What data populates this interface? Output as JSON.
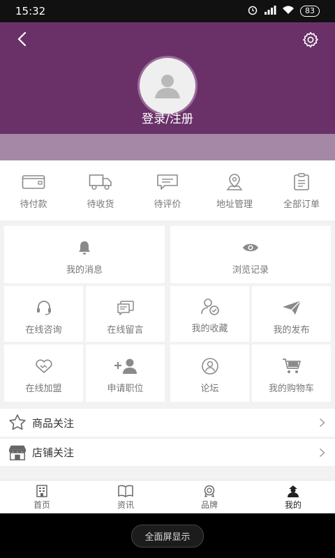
{
  "status_bar": {
    "time": "15:32",
    "battery": "83"
  },
  "header": {
    "login_label": "登录/注册"
  },
  "orders": [
    {
      "label": "待付款",
      "icon": "wallet-icon"
    },
    {
      "label": "待收货",
      "icon": "truck-icon"
    },
    {
      "label": "待评价",
      "icon": "comment-icon"
    },
    {
      "label": "地址管理",
      "icon": "location-pin-icon"
    },
    {
      "label": "全部订单",
      "icon": "clipboard-icon"
    }
  ],
  "grid": {
    "messages": "我的消息",
    "history": "浏览记录",
    "consult": "在线咨询",
    "leave_message": "在线留言",
    "favorites": "我的收藏",
    "posts": "我的发布",
    "join": "在线加盟",
    "apply": "申请职位",
    "forum": "论坛",
    "cart": "我的购物车"
  },
  "follow": [
    {
      "label": "商品关注",
      "icon": "star-icon"
    },
    {
      "label": "店铺关注",
      "icon": "store-icon"
    }
  ],
  "tabs": [
    {
      "label": "首页",
      "icon": "building-icon"
    },
    {
      "label": "资讯",
      "icon": "book-icon"
    },
    {
      "label": "品牌",
      "icon": "badge-icon"
    },
    {
      "label": "我的",
      "icon": "user-icon",
      "active": true
    }
  ],
  "nav": {
    "fullscreen_label": "全面屏显示"
  },
  "colors": {
    "header": "#6a3169",
    "band": "#a588a6",
    "icon_gray": "#8a8a8a"
  }
}
